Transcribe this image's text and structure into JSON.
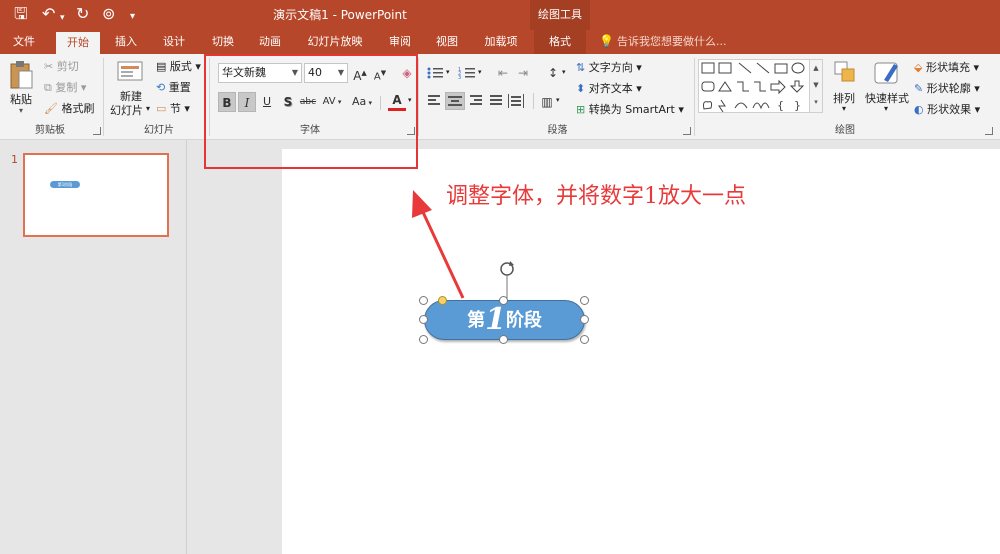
{
  "title_bar": {
    "document_title": "演示文稿1 - PowerPoint",
    "contextual_group": "绘图工具"
  },
  "tabs": [
    "文件",
    "开始",
    "插入",
    "设计",
    "切换",
    "动画",
    "幻灯片放映",
    "审阅",
    "视图",
    "加载项",
    "格式"
  ],
  "active_tab": "开始",
  "tell_me": "告诉我您想要做什么...",
  "ribbon": {
    "clipboard": {
      "paste": "粘贴",
      "cut": "剪切",
      "copy": "复制",
      "format_painter": "格式刷",
      "label": "剪贴板"
    },
    "slides": {
      "new_slide_line1": "新建",
      "new_slide_line2": "幻灯片",
      "layout": "版式",
      "reset": "重置",
      "section": "节",
      "label": "幻灯片"
    },
    "font": {
      "font_name": "华文新魏",
      "font_size": "40",
      "bold": "B",
      "italic": "I",
      "underline": "U",
      "shadow": "S",
      "strikethrough": "abc",
      "char_spacing": "AV",
      "change_case": "Aa",
      "font_color": "A",
      "label": "字体"
    },
    "paragraph": {
      "text_direction": "文字方向",
      "align_text": "对齐文本",
      "smartart": "转换为 SmartArt",
      "label": "段落"
    },
    "drawing": {
      "arrange": "排列",
      "quick_styles": "快速样式",
      "shape_fill": "形状填充",
      "shape_outline": "形状轮廓",
      "shape_effects": "形状效果",
      "label": "绘图"
    }
  },
  "slide_panel": {
    "slide_number": "1",
    "thumb_text": "第1阶段"
  },
  "shape": {
    "prefix": "第",
    "number": "1",
    "suffix": "阶段"
  },
  "annotation_text": "调整字体，并将数字1放大一点",
  "colors": {
    "accent": "#b7472a",
    "highlight": "#e53535",
    "shape_fill": "#5b9bd5"
  }
}
